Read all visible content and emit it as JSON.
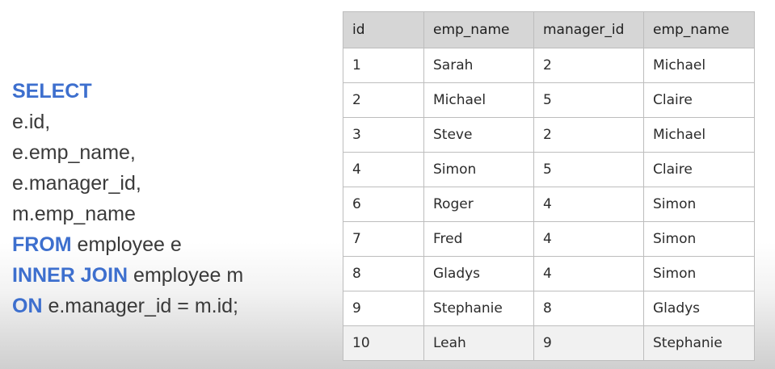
{
  "sql": {
    "select_kw": "SELECT",
    "col1": "e.id,",
    "col2": "e.emp_name,",
    "col3": "e.manager_id,",
    "col4": "m.emp_name",
    "from_kw": "FROM",
    "from_rest": " employee e",
    "join_kw": "INNER JOIN",
    "join_rest": " employee m",
    "on_kw": "ON",
    "on_rest": " e.manager_id = m.id;"
  },
  "table": {
    "headers": [
      "id",
      "emp_name",
      "manager_id",
      "emp_name"
    ],
    "rows": [
      [
        "1",
        "Sarah",
        "2",
        "Michael"
      ],
      [
        "2",
        "Michael",
        "5",
        "Claire"
      ],
      [
        "3",
        "Steve",
        "2",
        "Michael"
      ],
      [
        "4",
        "Simon",
        "5",
        "Claire"
      ],
      [
        "6",
        "Roger",
        "4",
        "Simon"
      ],
      [
        "7",
        "Fred",
        "4",
        "Simon"
      ],
      [
        "8",
        "Gladys",
        "4",
        "Simon"
      ],
      [
        "9",
        "Stephanie",
        "8",
        "Gladys"
      ],
      [
        "10",
        "Leah",
        "9",
        "Stephanie"
      ]
    ]
  },
  "colors": {
    "keyword": "#3d6fce",
    "text": "#3a3a3a",
    "header_bg": "#d6d6d6",
    "border": "#bdbdbd"
  }
}
